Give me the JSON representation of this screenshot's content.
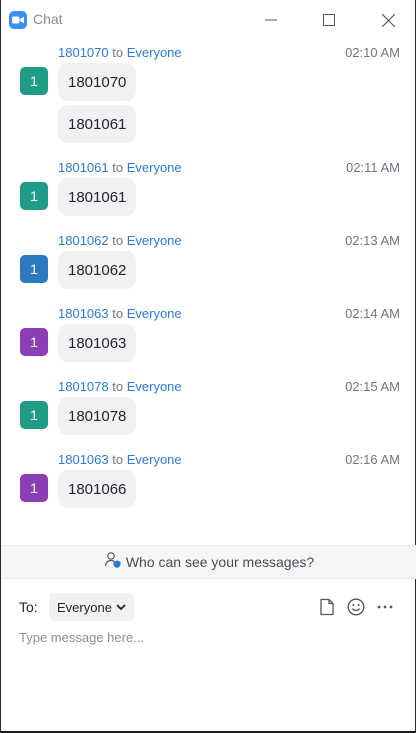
{
  "window": {
    "title": "Chat",
    "controls": [
      "minimize-icon",
      "maximize-icon",
      "close-icon"
    ]
  },
  "colors": {
    "link": "#2d7ad6",
    "avatar_green": "#1e9c85",
    "avatar_blue": "#2d79c0",
    "avatar_purple": "#8c3fb5"
  },
  "messages": [
    {
      "sender": "1801070",
      "to_word": "to",
      "recipient": "Everyone",
      "time": "02:10 AM",
      "avatar": "1",
      "avatar_color": "#1e9c85",
      "texts": [
        "1801070",
        "1801061"
      ]
    },
    {
      "sender": "1801061",
      "to_word": "to",
      "recipient": "Everyone",
      "time": "02:11 AM",
      "avatar": "1",
      "avatar_color": "#1e9c85",
      "texts": [
        "1801061"
      ]
    },
    {
      "sender": "1801062",
      "to_word": "to",
      "recipient": "Everyone",
      "time": "02:13 AM",
      "avatar": "1",
      "avatar_color": "#2d79c0",
      "texts": [
        "1801062"
      ]
    },
    {
      "sender": "1801063",
      "to_word": "to",
      "recipient": "Everyone",
      "time": "02:14 AM",
      "avatar": "1",
      "avatar_color": "#8c3fb5",
      "texts": [
        "1801063"
      ]
    },
    {
      "sender": "1801078",
      "to_word": "to",
      "recipient": "Everyone",
      "time": "02:15 AM",
      "avatar": "1",
      "avatar_color": "#1e9c85",
      "texts": [
        "1801078"
      ]
    },
    {
      "sender": "1801063",
      "to_word": "to",
      "recipient": "Everyone",
      "time": "02:16 AM",
      "avatar": "1",
      "avatar_color": "#8c3fb5",
      "texts": [
        "1801066"
      ]
    }
  ],
  "privacy": {
    "text": "Who can see your messages?",
    "icon": "user-shield-icon"
  },
  "composer": {
    "to_label": "To:",
    "recipient": "Everyone",
    "placeholder": "Type message here...",
    "tools": [
      "file-icon",
      "emoji-icon",
      "more-icon"
    ]
  }
}
